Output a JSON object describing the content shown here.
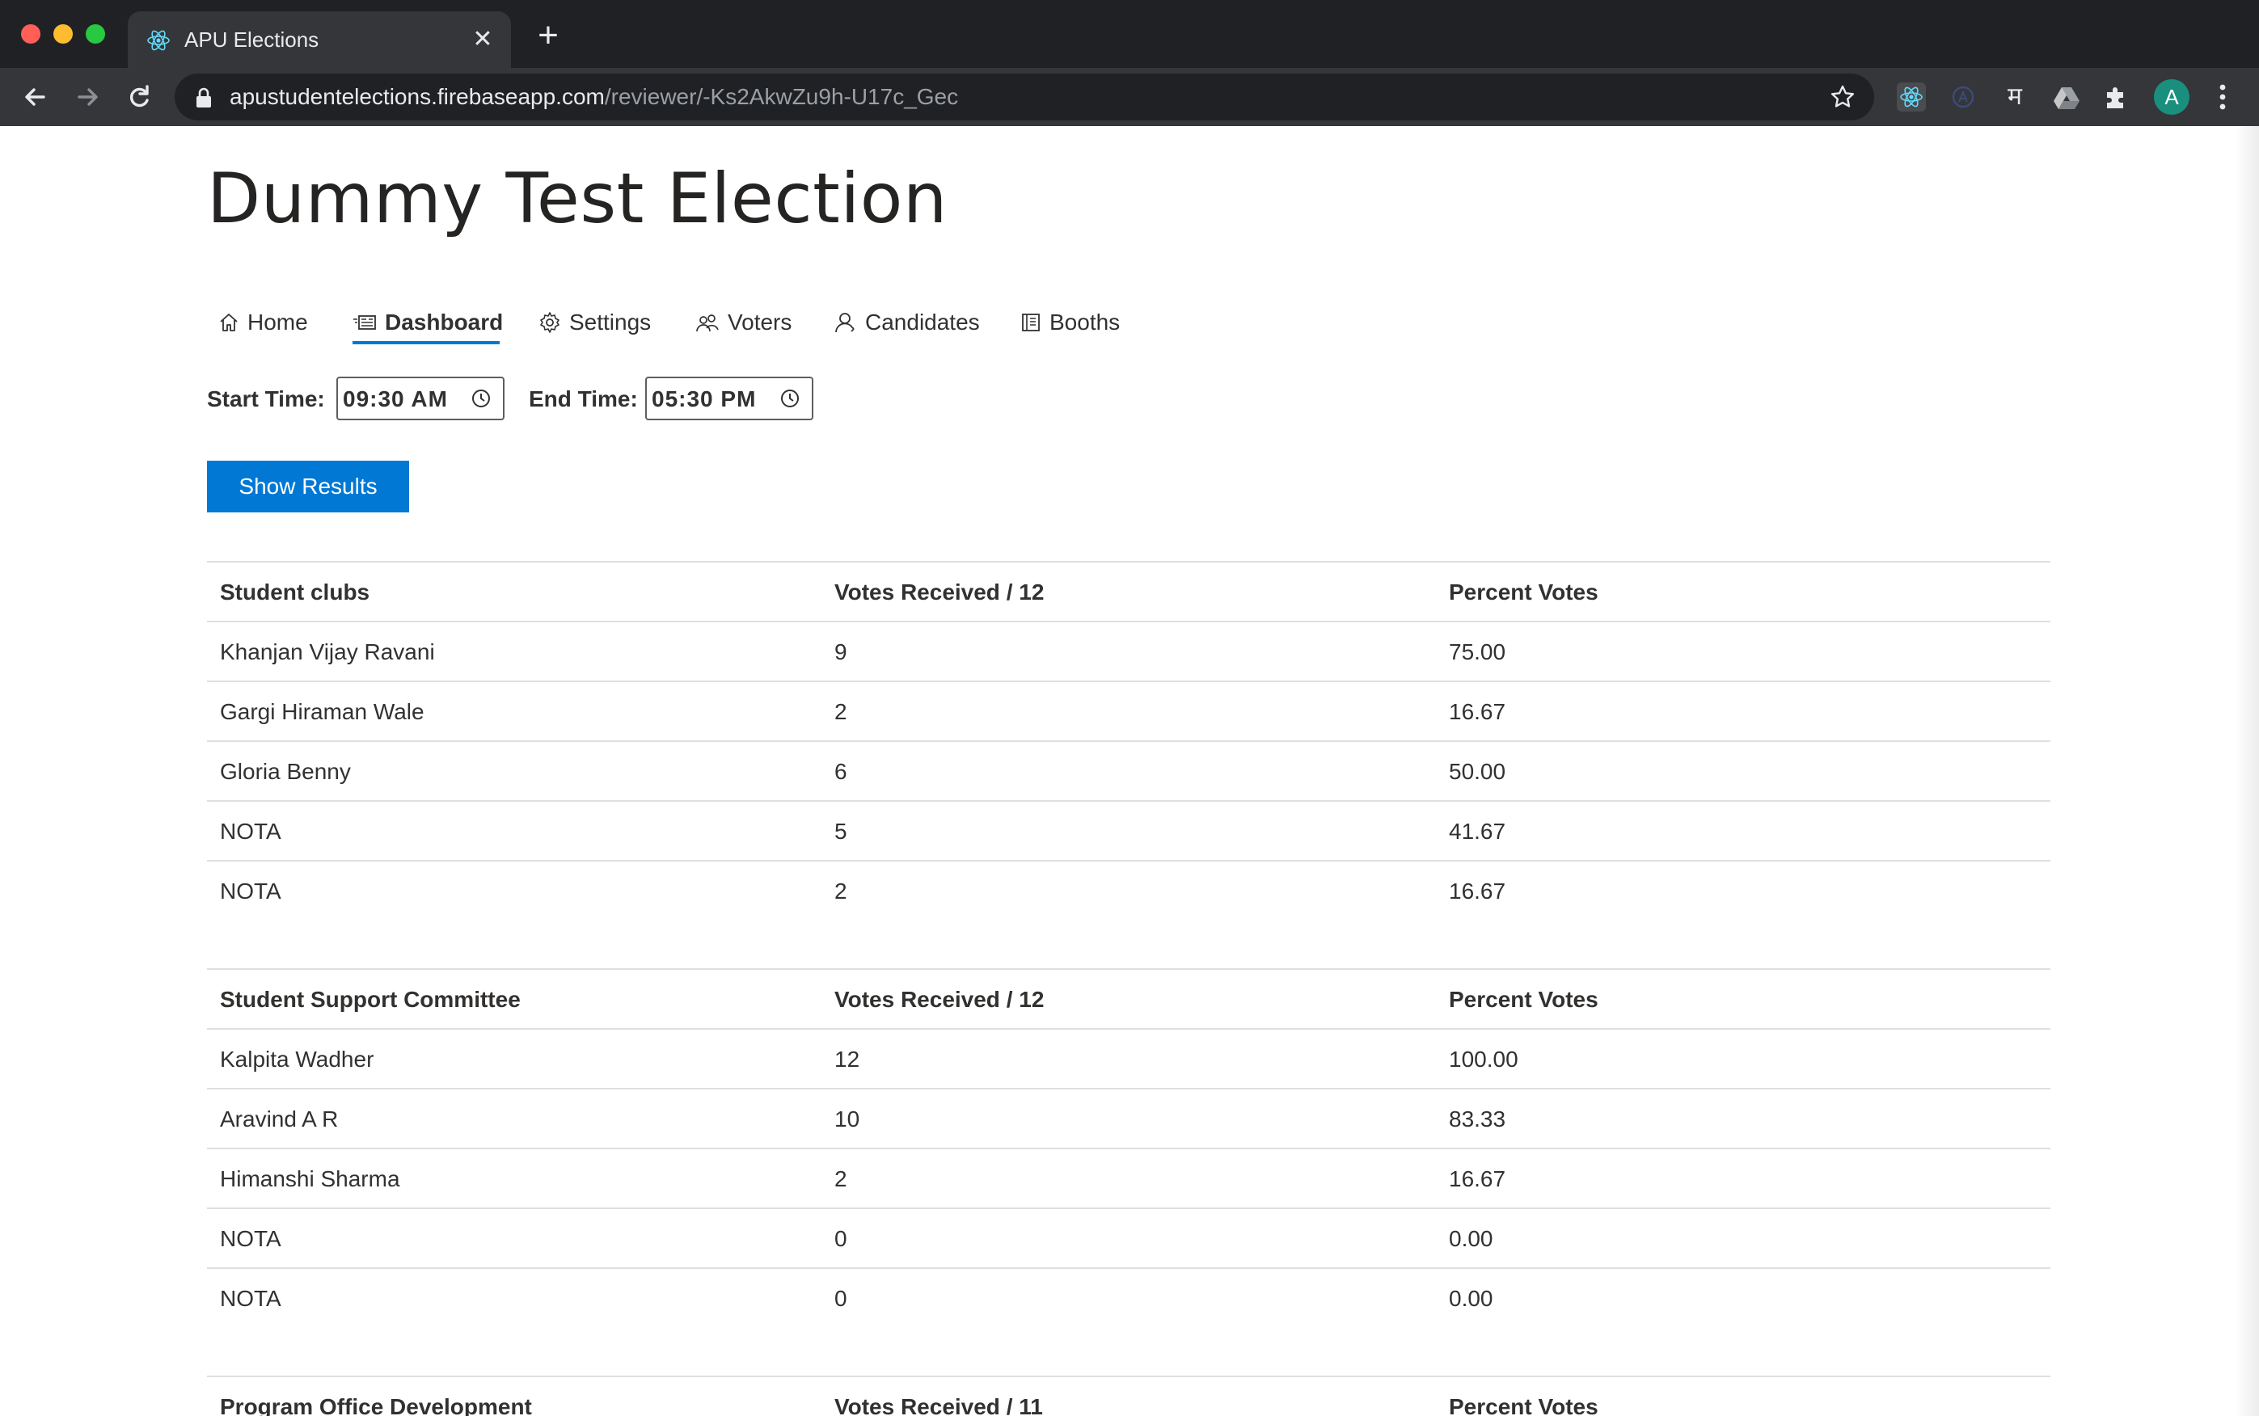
{
  "browser": {
    "tab_title": "APU Elections",
    "tab_close": "✕",
    "new_tab": "+",
    "url_host": "apustudentelections.firebaseapp.com",
    "url_path": "/reviewer/-Ks2AkwZu9h-U17c_Gec",
    "profile_initial": "A",
    "extension_letter": "म"
  },
  "page": {
    "title": "Dummy Test Election"
  },
  "nav": {
    "items": [
      {
        "label": "Home",
        "icon": "home-icon"
      },
      {
        "label": "Dashboard",
        "icon": "dashboard-icon",
        "active": true
      },
      {
        "label": "Settings",
        "icon": "gear-icon"
      },
      {
        "label": "Voters",
        "icon": "people-icon"
      },
      {
        "label": "Candidates",
        "icon": "person-icon"
      },
      {
        "label": "Booths",
        "icon": "booth-icon"
      }
    ]
  },
  "schedule": {
    "start_label": "Start Time:",
    "start_value": "09:30  AM",
    "end_label": "End Time:",
    "end_value": "05:30  PM"
  },
  "actions": {
    "show_results": "Show Results"
  },
  "results": [
    {
      "post": "Student clubs",
      "votes_header": "Votes Received / 12",
      "percent_header": "Percent Votes",
      "rows": [
        {
          "name": "Khanjan Vijay Ravani",
          "votes": "9",
          "percent": "75.00"
        },
        {
          "name": "Gargi Hiraman Wale",
          "votes": "2",
          "percent": "16.67"
        },
        {
          "name": "Gloria Benny",
          "votes": "6",
          "percent": "50.00"
        },
        {
          "name": "NOTA",
          "votes": "5",
          "percent": "41.67"
        },
        {
          "name": "NOTA",
          "votes": "2",
          "percent": "16.67"
        }
      ]
    },
    {
      "post": "Student Support Committee",
      "votes_header": "Votes Received / 12",
      "percent_header": "Percent Votes",
      "rows": [
        {
          "name": "Kalpita Wadher",
          "votes": "12",
          "percent": "100.00"
        },
        {
          "name": "Aravind A R",
          "votes": "10",
          "percent": "83.33"
        },
        {
          "name": "Himanshi Sharma",
          "votes": "2",
          "percent": "16.67"
        },
        {
          "name": "NOTA",
          "votes": "0",
          "percent": "0.00"
        },
        {
          "name": "NOTA",
          "votes": "0",
          "percent": "0.00"
        }
      ]
    },
    {
      "post": "Program Office Development",
      "votes_header": "Votes Received / 11",
      "percent_header": "Percent Votes",
      "rows": []
    }
  ],
  "colors": {
    "accent": "#0078d4",
    "chrome_dark": "#202124",
    "chrome_tab": "#35363a"
  }
}
